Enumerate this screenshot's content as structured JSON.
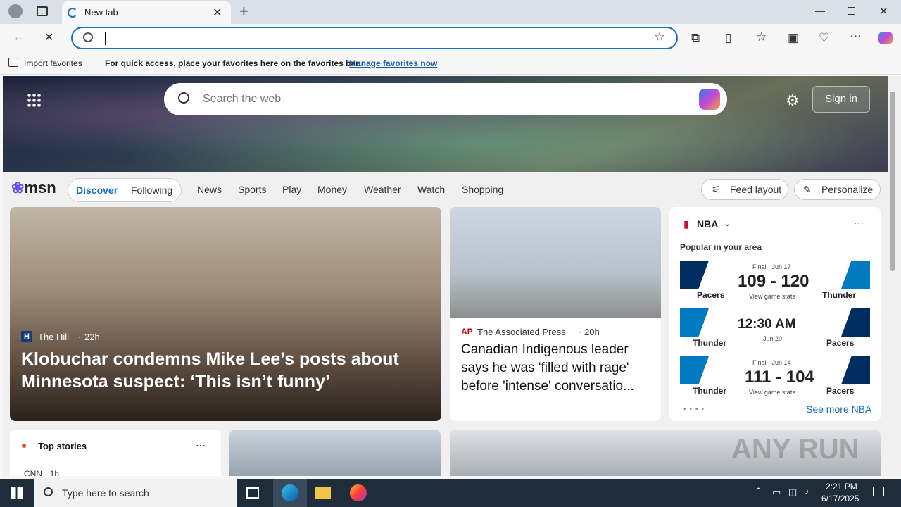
{
  "browser": {
    "tab_title": "New tab",
    "new_tab_symbol": "+",
    "address_value": "",
    "favorites_bar": {
      "import_label": "Import favorites",
      "prompt": "For quick access, place your favorites here on the favorites bar.",
      "manage_link": "Manage favorites now"
    }
  },
  "msn": {
    "search_placeholder": "Search the web",
    "sign_in": "Sign in",
    "logo_text": "msn",
    "tabs": [
      {
        "label": "Discover",
        "active": true
      },
      {
        "label": "Following",
        "active": false
      }
    ],
    "nav": [
      "News",
      "Sports",
      "Play",
      "Money",
      "Weather",
      "Watch",
      "Shopping"
    ],
    "feed_layout": "Feed layout",
    "personalize": "Personalize"
  },
  "main_story": {
    "source": "The Hill",
    "age": "22h",
    "title": "Klobuchar condemns Mike Lee’s posts about Minnesota suspect: ‘This isn’t funny’"
  },
  "side_story": {
    "source": "The Associated Press",
    "age": "20h",
    "title": "Canadian Indigenous leader says he was 'filled with rage' before 'intense' conversatio..."
  },
  "nba": {
    "league": "NBA",
    "popular": "Popular in your area",
    "see_more": "See more NBA",
    "games": [
      {
        "status": "Final · Jun 17",
        "score": "109 - 120",
        "home": "Pacers",
        "away": "Thunder",
        "link": "View game stats"
      },
      {
        "status": "",
        "score": "12:30 AM",
        "home": "Thunder",
        "away": "Pacers",
        "link": "Jun 20"
      },
      {
        "status": "Final · Jun 14",
        "score": "111 - 104",
        "home": "Thunder",
        "away": "Pacers",
        "link": "View game stats"
      }
    ]
  },
  "top_stories": {
    "label": "Top stories",
    "first_source": "CNN · 1h"
  },
  "watermark": "ANY RUN",
  "taskbar": {
    "search_placeholder": "Type here to search",
    "time": "2:21 PM",
    "date": "6/17/2025"
  },
  "colors": {
    "accent": "#1b6ec2",
    "taskbar": "#1f2c3a",
    "pacers": "#002d62",
    "thunder": "#007ac1"
  }
}
